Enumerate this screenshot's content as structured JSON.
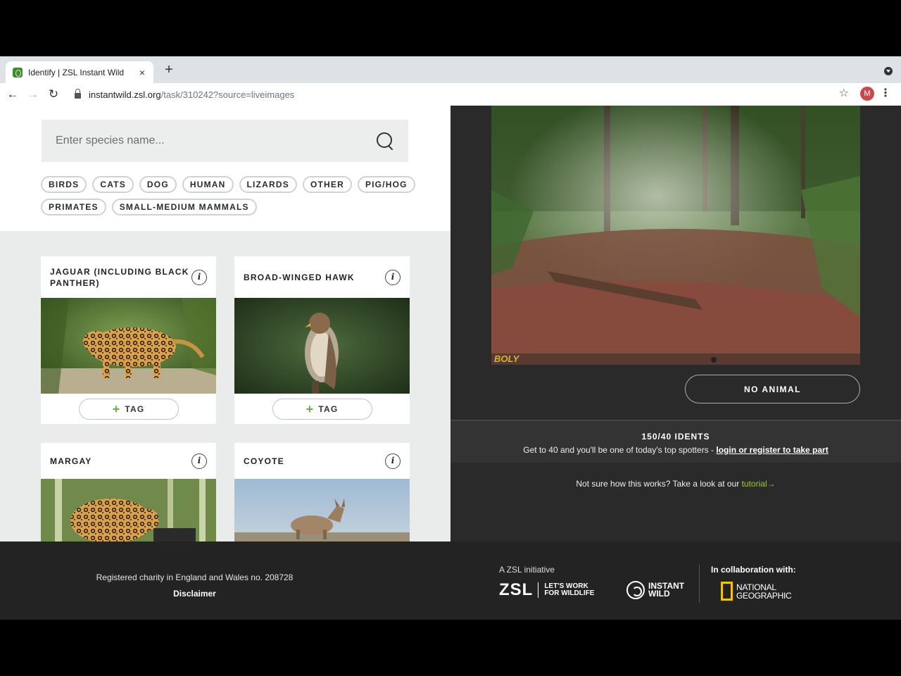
{
  "browser": {
    "tab_title": "Identify | ZSL Instant Wild",
    "close_glyph": "×",
    "new_tab_glyph": "+",
    "url_host": "instantwild.zsl.org",
    "url_path": "/task/310242?source=liveimages",
    "back_glyph": "←",
    "forward_glyph": "→",
    "reload_glyph": "↻",
    "star_glyph": "☆",
    "avatar_letter": "M",
    "menu_glyph": "⋮"
  },
  "search": {
    "placeholder": "Enter species name..."
  },
  "chips": [
    "BIRDS",
    "CATS",
    "DOG",
    "HUMAN",
    "LIZARDS",
    "OTHER",
    "PIG/HOG",
    "PRIMATES",
    "SMALL-MEDIUM MAMMALS"
  ],
  "cards": [
    {
      "title": "JAGUAR (INCLUDING BLACK PANTHER)",
      "tag_label": "TAG",
      "info": "i",
      "plus": "+"
    },
    {
      "title": "BROAD-WINGED HAWK",
      "tag_label": "TAG",
      "info": "i",
      "plus": "+"
    },
    {
      "title": "MARGAY",
      "info": "i"
    },
    {
      "title": "COYOTE",
      "info": "i"
    }
  ],
  "camera": {
    "no_animal_label": "NO ANIMAL",
    "brand_mark": "BOLY"
  },
  "idents": {
    "count": "150/40 IDENTS",
    "text": "Get to 40 and you'll be one of today's top spotters - ",
    "link": "login or register to take part"
  },
  "tutorial": {
    "text": "Not sure how this works? Take a look at our ",
    "link": "tutorial",
    "arrow": "→"
  },
  "footer": {
    "charity": "Registered charity in England and Wales no. 208728",
    "disclaimer": "Disclaimer",
    "initiative": "A ZSL initiative",
    "zsl": "ZSL",
    "zsl_tag_1": "LET'S WORK",
    "zsl_tag_2": "FOR WILDLIFE",
    "iw_1": "INSTANT",
    "iw_2": "WILD",
    "collab": "In collaboration with:",
    "natgeo_1": "NATIONAL",
    "natgeo_2": "GEOGRAPHIC"
  },
  "colors": {
    "accent_green": "#9dc93d",
    "natgeo_yellow": "#f2c500",
    "dark_panel": "#2a2a2a"
  }
}
